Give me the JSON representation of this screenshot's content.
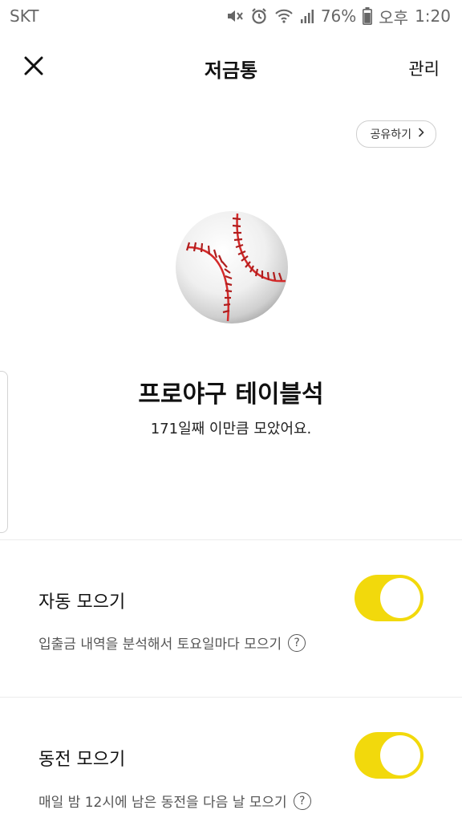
{
  "status_bar": {
    "carrier": "SKT",
    "battery": "76%",
    "ampm": "오후",
    "time": "1:20",
    "icons": [
      "mute-icon",
      "alarm-icon",
      "wifi-icon",
      "signal-icon",
      "battery-icon"
    ]
  },
  "header": {
    "title": "저금통",
    "manage_label": "관리",
    "close_icon": "close-icon"
  },
  "share": {
    "label": "공유하기",
    "chevron": "›"
  },
  "goal": {
    "icon": "baseball-icon",
    "title": "프로야구 테이블석",
    "subtitle": "171일째 이만큼 모았어요."
  },
  "settings": [
    {
      "title": "자동 모으기",
      "description": "입출금 내역을 분석해서 토요일마다 모으기",
      "help": "?",
      "enabled": true
    },
    {
      "title": "동전 모으기",
      "description": "매일 밤 12시에 남은 동전을 다음 날 모으기",
      "help": "?",
      "enabled": true
    }
  ],
  "colors": {
    "toggle_on": "#f2d90c",
    "seam_red": "#d42a2a"
  }
}
